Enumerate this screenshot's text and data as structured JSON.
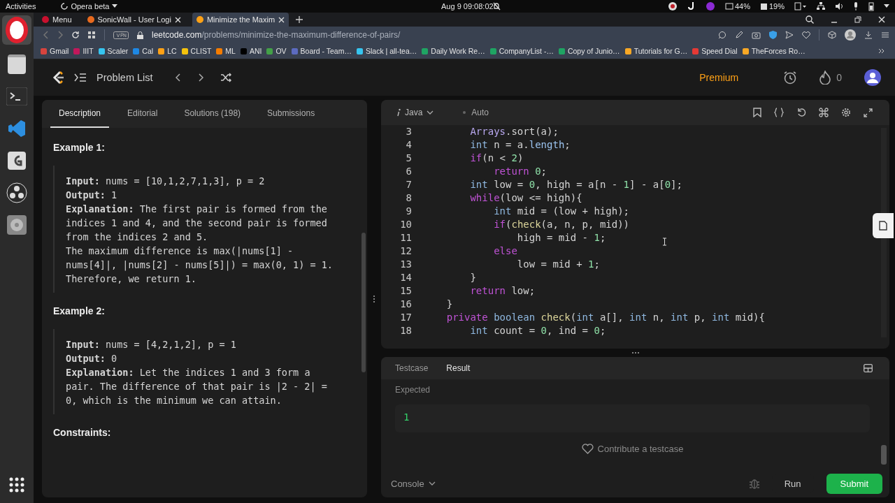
{
  "system_bar": {
    "activities": "Activities",
    "app": "Opera beta",
    "clock": "Aug 9  09:08:02",
    "cpu": "44%",
    "memory": "19%"
  },
  "browser": {
    "tabs": [
      {
        "label": "Menu",
        "selected": false,
        "color": "#c8102e"
      },
      {
        "label": "SonicWall - User Logi",
        "selected": false,
        "color": "#e86a1e"
      },
      {
        "label": "Minimize the Maxim",
        "selected": true,
        "color": "#ffa116"
      }
    ],
    "url_host": "leetcode.com",
    "url_path": "/problems/minimize-the-maximum-difference-of-pairs/",
    "bookmarks": [
      {
        "label": "Gmail",
        "color": "#d7443e"
      },
      {
        "label": "IIIT",
        "color": "#c2185b"
      },
      {
        "label": "Scaler",
        "color": "#36c5f0"
      },
      {
        "label": "Cal",
        "color": "#1e88e5"
      },
      {
        "label": "LC",
        "color": "#ffa116"
      },
      {
        "label": "CLIST",
        "color": "#f4c20d"
      },
      {
        "label": "ML",
        "color": "#f57c00"
      },
      {
        "label": "ANI",
        "color": "#000000"
      },
      {
        "label": "OV",
        "color": "#43a047"
      },
      {
        "label": "Board - Team…",
        "color": "#5c6bc0"
      },
      {
        "label": "Slack | all-tea…",
        "color": "#36c5f0"
      },
      {
        "label": "Daily Work Re…",
        "color": "#1fa463"
      },
      {
        "label": "CompanyList -…",
        "color": "#1fa463"
      },
      {
        "label": "Copy of Junio…",
        "color": "#1fa463"
      },
      {
        "label": "Tutorials for G…",
        "color": "#f9a825"
      },
      {
        "label": "Speed Dial",
        "color": "#e53935"
      },
      {
        "label": "TheForces Ro…",
        "color": "#f9a825"
      }
    ]
  },
  "header": {
    "title": "Problem List",
    "premium": "Premium",
    "streak": "0"
  },
  "description": {
    "tabs": [
      {
        "label": "Description",
        "selected": true
      },
      {
        "label": "Editorial",
        "selected": false
      },
      {
        "label": "Solutions (198)",
        "selected": false
      },
      {
        "label": "Submissions",
        "selected": false
      }
    ],
    "examples": [
      {
        "title": "Example 1:",
        "lines": [
          "**Input:** nums = [10,1,2,7,1,3], p = 2",
          "**Output:** 1",
          "**Explanation:** The first pair is formed from the",
          "indices 1 and 4, and the second pair is formed",
          "from the indices 2 and 5.",
          "The maximum difference is max(|nums[1] -",
          "nums[4]|, |nums[2] - nums[5]|) = max(0, 1) = 1.",
          "Therefore, we return 1."
        ]
      },
      {
        "title": "Example 2:",
        "lines": [
          "**Input:** nums = [4,2,1,2], p = 1",
          "**Output:** 0",
          "**Explanation:** Let the indices 1 and 3 form a",
          "pair. The difference of that pair is |2 - 2| =",
          "0, which is the minimum we can attain."
        ]
      }
    ],
    "constraints_title": "Constraints:"
  },
  "editor": {
    "language": "Java",
    "mode": "Auto",
    "lines": [
      {
        "number": "3",
        "tokens": [
          {
            "text": "        Arrays",
            "kind": "class"
          },
          {
            "text": ".sort(a);",
            "kind": "plain"
          }
        ]
      },
      {
        "number": "4",
        "tokens": [
          {
            "text": "        int",
            "kind": "type"
          },
          {
            "text": " n = a.",
            "kind": "plain"
          },
          {
            "text": "length",
            "kind": "field"
          },
          {
            "text": ";",
            "kind": "plain"
          }
        ]
      },
      {
        "number": "5",
        "tokens": [
          {
            "text": "        if",
            "kind": "keyword"
          },
          {
            "text": "(n < ",
            "kind": "plain"
          },
          {
            "text": "2",
            "kind": "number"
          },
          {
            "text": ")",
            "kind": "plain"
          }
        ]
      },
      {
        "number": "6",
        "tokens": [
          {
            "text": "            return",
            "kind": "keyword"
          },
          {
            "text": " 0",
            "kind": "number"
          },
          {
            "text": ";",
            "kind": "plain"
          }
        ]
      },
      {
        "number": "7",
        "tokens": [
          {
            "text": "        int",
            "kind": "type"
          },
          {
            "text": " low = ",
            "kind": "plain"
          },
          {
            "text": "0",
            "kind": "number"
          },
          {
            "text": ", high = a[n - ",
            "kind": "plain"
          },
          {
            "text": "1",
            "kind": "number"
          },
          {
            "text": "] - a[",
            "kind": "plain"
          },
          {
            "text": "0",
            "kind": "number"
          },
          {
            "text": "];",
            "kind": "plain"
          }
        ]
      },
      {
        "number": "8",
        "tokens": [
          {
            "text": "        while",
            "kind": "keyword"
          },
          {
            "text": "(low <= high){",
            "kind": "plain"
          }
        ]
      },
      {
        "number": "9",
        "tokens": [
          {
            "text": "            int",
            "kind": "type"
          },
          {
            "text": " mid = (low + high);",
            "kind": "plain"
          }
        ]
      },
      {
        "number": "10",
        "tokens": [
          {
            "text": "            if",
            "kind": "keyword"
          },
          {
            "text": "(",
            "kind": "plain"
          },
          {
            "text": "check",
            "kind": "function"
          },
          {
            "text": "(a, n, p, mid))",
            "kind": "plain"
          }
        ]
      },
      {
        "number": "11",
        "tokens": [
          {
            "text": "                high = mid - ",
            "kind": "plain"
          },
          {
            "text": "1",
            "kind": "number"
          },
          {
            "text": ";",
            "kind": "plain"
          }
        ]
      },
      {
        "number": "12",
        "tokens": [
          {
            "text": "            else",
            "kind": "keyword"
          }
        ]
      },
      {
        "number": "13",
        "tokens": [
          {
            "text": "                low = mid + ",
            "kind": "plain"
          },
          {
            "text": "1",
            "kind": "number"
          },
          {
            "text": ";",
            "kind": "plain"
          }
        ]
      },
      {
        "number": "14",
        "tokens": [
          {
            "text": "        }",
            "kind": "plain"
          }
        ]
      },
      {
        "number": "15",
        "tokens": [
          {
            "text": "        return",
            "kind": "keyword"
          },
          {
            "text": " low;",
            "kind": "plain"
          }
        ]
      },
      {
        "number": "16",
        "tokens": [
          {
            "text": "    }",
            "kind": "plain"
          }
        ]
      },
      {
        "number": "17",
        "tokens": [
          {
            "text": "    private",
            "kind": "keyword"
          },
          {
            "text": " boolean",
            "kind": "type"
          },
          {
            "text": " check",
            "kind": "function"
          },
          {
            "text": "(",
            "kind": "plain"
          },
          {
            "text": "int",
            "kind": "type"
          },
          {
            "text": " a[], ",
            "kind": "plain"
          },
          {
            "text": "int",
            "kind": "type"
          },
          {
            "text": " n, ",
            "kind": "plain"
          },
          {
            "text": "int",
            "kind": "type"
          },
          {
            "text": " p, ",
            "kind": "plain"
          },
          {
            "text": "int",
            "kind": "type"
          },
          {
            "text": " mid){",
            "kind": "plain"
          }
        ]
      },
      {
        "number": "18",
        "tokens": [
          {
            "text": "        int",
            "kind": "type"
          },
          {
            "text": " count = ",
            "kind": "plain"
          },
          {
            "text": "0",
            "kind": "number"
          },
          {
            "text": ", ind = ",
            "kind": "plain"
          },
          {
            "text": "0",
            "kind": "number"
          },
          {
            "text": ";",
            "kind": "plain"
          }
        ]
      }
    ]
  },
  "result": {
    "tabs": [
      {
        "label": "Testcase",
        "selected": false
      },
      {
        "label": "Result",
        "selected": true
      }
    ],
    "expected_label": "Expected",
    "expected_value": "1",
    "contribute": "Contribute a testcase",
    "console": "Console",
    "run": "Run",
    "submit": "Submit"
  }
}
